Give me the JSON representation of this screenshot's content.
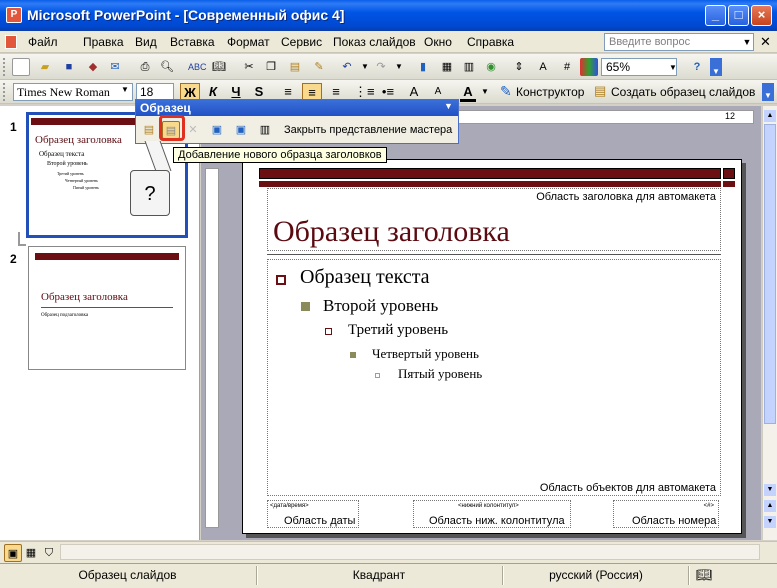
{
  "window": {
    "title": "Microsoft PowerPoint - [Современный офис 4]",
    "controls": {
      "minimize": "_",
      "maximize": "□",
      "close": "×"
    }
  },
  "menu": {
    "items": [
      "Файл",
      "Правка",
      "Вид",
      "Вставка",
      "Формат",
      "Сервис",
      "Показ слайдов",
      "Окно",
      "Справка"
    ],
    "help_placeholder": "Введите вопрос"
  },
  "standard_toolbar": {
    "zoom": "65%"
  },
  "format_toolbar": {
    "font": "Times New Roman",
    "size": "18",
    "bold": "Ж",
    "italic": "К",
    "underline": "Ч",
    "shadow": "S",
    "font_color": "A",
    "designer": "Конструктор",
    "new_slide_master": "Создать образец слайдов"
  },
  "master_toolbar": {
    "title": "Образец",
    "close_label": "Закрыть представление мастера",
    "tooltip": "Добавление нового образца заголовков"
  },
  "thumbnails": [
    {
      "number": "1",
      "title": "Образец заголовка",
      "text": "Образец текста",
      "level2": "Второй уровень",
      "level3": "Третий уровень",
      "level4": "Четвертый уровень",
      "level5": "Пятый уровень"
    },
    {
      "number": "2",
      "title": "Образец заголовка",
      "subtitle": "Образец подзаголовка"
    }
  ],
  "callout": "?",
  "slide": {
    "title_area_label": "Область заголовка для автомакета",
    "title": "Образец заголовка",
    "levels": [
      "Образец текста",
      "Второй уровень",
      "Третий уровень",
      "Четвертый уровень",
      "Пятый уровень"
    ],
    "objects_area_label": "Область объектов для автомакета",
    "footer": {
      "date_tag": "<дата/время>",
      "date_label": "Область даты",
      "footer_tag": "<нижний колонтитул>",
      "footer_label": "Область ниж. колонтитула",
      "number_tag": "<#>",
      "number_label": "Область номера"
    }
  },
  "status": {
    "view": "Образец слайдов",
    "design": "Квадрант",
    "language": "русский (Россия)"
  },
  "colors": {
    "accent_dark_red": "#6b0f12",
    "title_text": "#5a0a10",
    "highlight_red": "#e03020",
    "bullet_olive": "#8a8a5a"
  }
}
